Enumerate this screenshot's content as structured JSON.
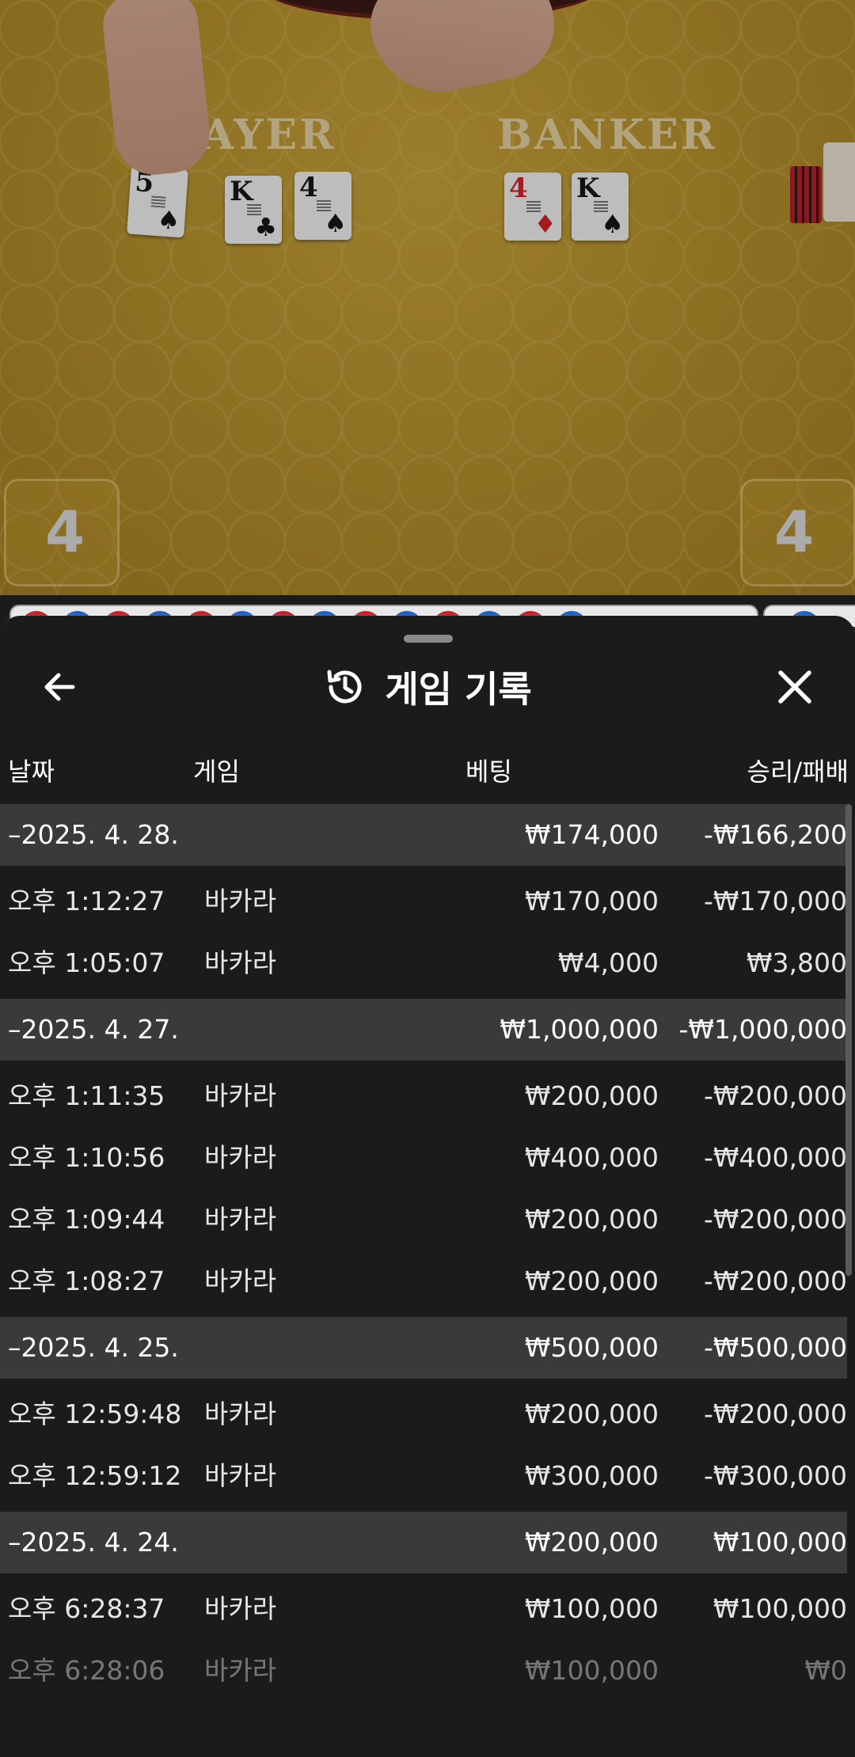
{
  "video": {
    "player_label": "LAYER",
    "banker_label": "BANKER",
    "player_cards": [
      {
        "rank": "5",
        "suit": "♠",
        "color": "black"
      },
      {
        "rank": "K",
        "suit": "♣",
        "color": "black"
      },
      {
        "rank": "4",
        "suit": "♠",
        "color": "black"
      }
    ],
    "banker_cards": [
      {
        "rank": "4",
        "suit": "♦",
        "color": "red"
      },
      {
        "rank": "K",
        "suit": "♠",
        "color": "black"
      }
    ],
    "player_score": "4",
    "banker_score": "4"
  },
  "sheet": {
    "title": "게임 기록",
    "back_icon": "arrow-left-icon",
    "close_icon": "close-icon",
    "title_icon": "history-icon"
  },
  "columns": {
    "date": "날짜",
    "game": "게임",
    "bet": "베팅",
    "result": "승리/패배"
  },
  "groups": [
    {
      "date": "–2025. 4. 28.",
      "bet": "₩174,000",
      "result": "-₩166,200",
      "rows": [
        {
          "time": "오후 1:12:27",
          "game": "바카라",
          "bet": "₩170,000",
          "result": "-₩170,000"
        },
        {
          "time": "오후 1:05:07",
          "game": "바카라",
          "bet": "₩4,000",
          "result": "₩3,800"
        }
      ]
    },
    {
      "date": "–2025. 4. 27.",
      "bet": "₩1,000,000",
      "result": "-₩1,000,000",
      "rows": [
        {
          "time": "오후 1:11:35",
          "game": "바카라",
          "bet": "₩200,000",
          "result": "-₩200,000"
        },
        {
          "time": "오후 1:10:56",
          "game": "바카라",
          "bet": "₩400,000",
          "result": "-₩400,000"
        },
        {
          "time": "오후 1:09:44",
          "game": "바카라",
          "bet": "₩200,000",
          "result": "-₩200,000"
        },
        {
          "time": "오후 1:08:27",
          "game": "바카라",
          "bet": "₩200,000",
          "result": "-₩200,000"
        }
      ]
    },
    {
      "date": "–2025. 4. 25.",
      "bet": "₩500,000",
      "result": "-₩500,000",
      "rows": [
        {
          "time": "오후 12:59:48",
          "game": "바카라",
          "bet": "₩200,000",
          "result": "-₩200,000"
        },
        {
          "time": "오후 12:59:12",
          "game": "바카라",
          "bet": "₩300,000",
          "result": "-₩300,000"
        }
      ]
    },
    {
      "date": "–2025. 4. 24.",
      "bet": "₩200,000",
      "result": "₩100,000",
      "rows": [
        {
          "time": "오후 6:28:37",
          "game": "바카라",
          "bet": "₩100,000",
          "result": "₩100,000"
        },
        {
          "time": "오후 6:28:06",
          "game": "바카라",
          "bet": "₩100,000",
          "result": "₩0"
        }
      ]
    }
  ]
}
